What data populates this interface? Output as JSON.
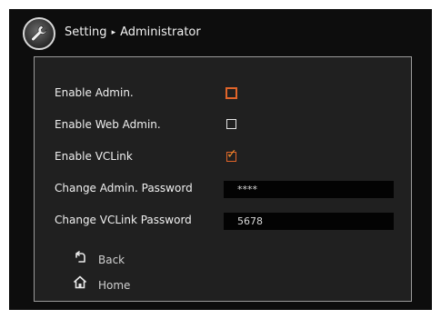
{
  "header": {
    "section": "Setting",
    "page": "Administrator",
    "separator": "▸",
    "icon": "wrench-icon"
  },
  "settings": {
    "enable_admin": {
      "label": "Enable Admin.",
      "checked": false
    },
    "enable_web_admin": {
      "label": "Enable Web Admin.",
      "checked": false
    },
    "enable_vclink": {
      "label": "Enable VCLink",
      "checked": true
    },
    "change_admin_password": {
      "label": "Change Admin. Password",
      "value": "****"
    },
    "change_vclink_password": {
      "label": "Change VCLink Password",
      "value": "5678"
    }
  },
  "nav": {
    "back": {
      "label": "Back",
      "icon": "back-arrow-icon"
    },
    "home": {
      "label": "Home",
      "icon": "home-icon"
    }
  },
  "colors": {
    "focus": "#e0642a",
    "check": "#f08a2a",
    "panel_bg": "#202020",
    "screen_bg": "#0d0d0d"
  }
}
